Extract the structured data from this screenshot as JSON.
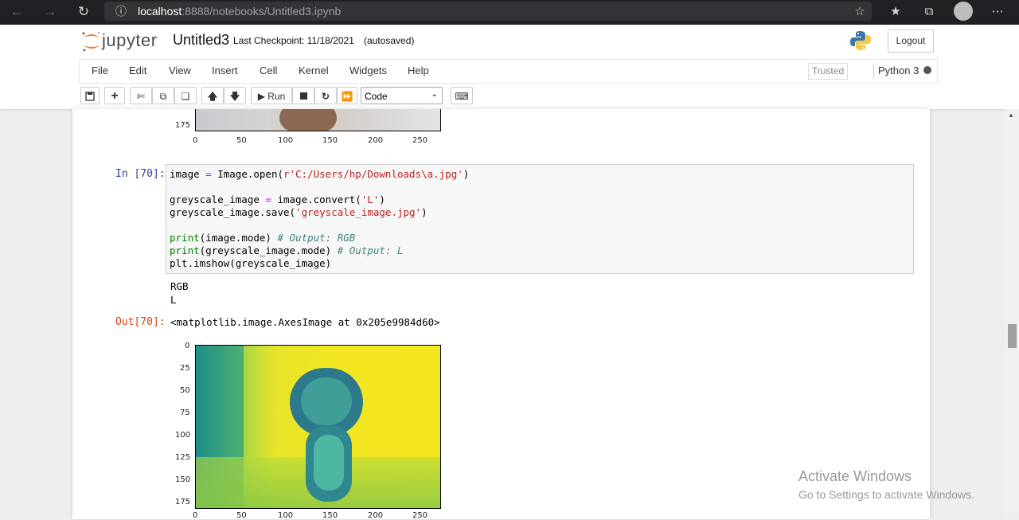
{
  "browser": {
    "url_host": "localhost",
    "url_path": ":8888/notebooks/Untitled3.ipynb"
  },
  "header": {
    "logo_text": "jupyter",
    "notebook_title": "Untitled3",
    "checkpoint": "Last Checkpoint: 11/18/2021",
    "autosave_status": "(autosaved)",
    "logout_label": "Logout"
  },
  "menubar": {
    "items": [
      "File",
      "Edit",
      "View",
      "Insert",
      "Cell",
      "Kernel",
      "Widgets",
      "Help"
    ],
    "trusted_label": "Trusted",
    "kernel_name": "Python 3"
  },
  "toolbar": {
    "run_label": "Run",
    "cell_type": "Code"
  },
  "cells": {
    "prev_axis": {
      "y_tick": "175",
      "x_ticks": [
        "0",
        "50",
        "100",
        "150",
        "200",
        "250"
      ]
    },
    "cell70": {
      "in_prompt": "In [70]:",
      "out_prompt": "Out[70]:",
      "code": {
        "line1": {
          "a": "image ",
          "b": "=",
          "c": " Image.open(",
          "d": "r'C:/Users/hp/Downloads\\a.jpg'",
          "e": ")"
        },
        "line3": {
          "a": "greyscale_image ",
          "b": "=",
          "c": " image.convert(",
          "d": "'L'",
          "e": ")"
        },
        "line4": {
          "a": "greyscale_image.save(",
          "d": "'greyscale_image.jpg'",
          "e": ")"
        },
        "line6": {
          "a": "print",
          "c": "(image.mode) ",
          "f": "# Output: RGB"
        },
        "line7": {
          "a": "print",
          "c": "(greyscale_image.mode) ",
          "f": "# Output: L"
        },
        "line8": {
          "a": "plt.imshow(greyscale_image)"
        }
      },
      "stdout": [
        "RGB",
        "L"
      ],
      "result": "<matplotlib.image.AxesImage at 0x205e9984d60>",
      "plot": {
        "y_ticks": [
          "0",
          "25",
          "50",
          "75",
          "100",
          "125",
          "150",
          "175"
        ],
        "x_ticks": [
          "0",
          "50",
          "100",
          "150",
          "200",
          "250"
        ]
      }
    }
  },
  "watermark": {
    "line1": "Activate Windows",
    "line2": "Go to Settings to activate Windows."
  },
  "colors": {
    "prompt_in": "#303f9f",
    "prompt_out": "#d84315",
    "viridis_yellow": "#f3e51f",
    "viridis_teal": "#2a9a8a"
  }
}
